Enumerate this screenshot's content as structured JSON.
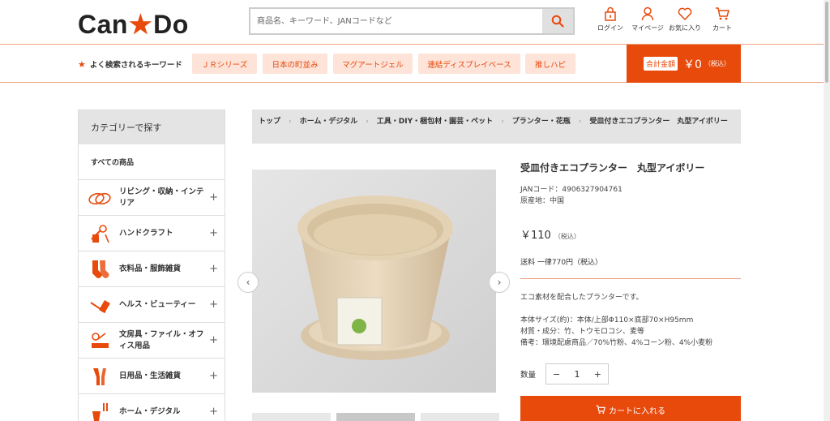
{
  "header": {
    "logo_left": "Can",
    "logo_star": "★",
    "logo_right": "Do",
    "search_placeholder": "商品名、キーワード、JANコードなど",
    "icons": [
      {
        "name": "login",
        "label": "ログイン"
      },
      {
        "name": "mypage",
        "label": "マイページ"
      },
      {
        "name": "favorites",
        "label": "お気に入り"
      },
      {
        "name": "cart",
        "label": "カート"
      }
    ]
  },
  "keywords": {
    "title": "よく検索されるキーワード",
    "chips": [
      "ＪＲシリーズ",
      "日本の町並み",
      "マグアートジェル",
      "連結ディスプレイベース",
      "推しハピ"
    ]
  },
  "total": {
    "label": "合計金額",
    "value": "￥0",
    "tax": "（税込）"
  },
  "sidebar": {
    "heading": "カテゴリーで探す",
    "all": "すべての商品",
    "items": [
      {
        "label": "リビング・収納・インテリア",
        "icon": "living-icon"
      },
      {
        "label": "ハンドクラフト",
        "icon": "craft-icon"
      },
      {
        "label": "衣料品・服飾雑貨",
        "icon": "clothing-icon"
      },
      {
        "label": "ヘルス・ビューティー",
        "icon": "beauty-icon"
      },
      {
        "label": "文房具・ファイル・オフィス用品",
        "icon": "stationery-icon"
      },
      {
        "label": "日用品・生活雑貨",
        "icon": "daily-goods-icon"
      },
      {
        "label": "ホーム・デジタル",
        "icon": "home-digital-icon"
      }
    ]
  },
  "breadcrumb": [
    "トップ",
    "ホーム・デジタル",
    "工具・DIY・梱包材・園芸・ペット",
    "プランター・花瓶",
    "受皿付きエコプランター　丸型アイボリー"
  ],
  "product": {
    "title": "受皿付きエコプランター　丸型アイボリー",
    "jan": "JANコード：4906327904761",
    "origin": "原産地：中国",
    "price": "￥110",
    "price_tax": "（税込）",
    "shipping": "送料 一律770円（税込）",
    "desc1": "エコ素材を配合したプランターです。",
    "desc2": "本体サイズ(約)：本体/上部Φ110×底部70×H95mm",
    "desc3": "材質・成分：竹、トウモロコシ、麦等",
    "desc4": "備考：環境配慮商品／70%竹粉、4%コーン粉、4%小麦粉",
    "qty_label": "数量",
    "qty_value": "1",
    "qty_minus": "−",
    "qty_plus": "+",
    "cart_button": "カートに入れる"
  },
  "colors": {
    "accent": "#e84a0c",
    "chip_bg": "#fde3d8"
  }
}
